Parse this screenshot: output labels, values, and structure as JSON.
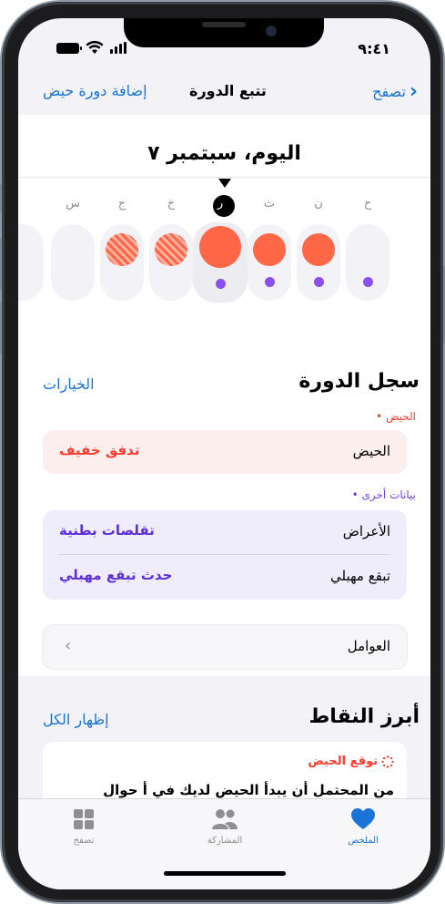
{
  "status": {
    "time": "٩:٤١"
  },
  "nav": {
    "back_label": "تصفح",
    "title": "تتبع الدورة",
    "add_label": "إضافة دورة حيض"
  },
  "calendar": {
    "today_label": "اليوم، سبتمبر ٧",
    "days": [
      {
        "letter": "",
        "flow": "none",
        "spot": false
      },
      {
        "letter": "س",
        "flow": "none",
        "spot": false
      },
      {
        "letter": "ج",
        "flow": "predicted",
        "spot": false
      },
      {
        "letter": "خ",
        "flow": "predicted",
        "spot": false
      },
      {
        "letter": "ر",
        "flow": "heavy",
        "spot": true,
        "today": true
      },
      {
        "letter": "ث",
        "flow": "medium",
        "spot": true
      },
      {
        "letter": "ن",
        "flow": "medium",
        "spot": true
      },
      {
        "letter": "ح",
        "flow": "none",
        "spot": true
      }
    ],
    "colors": {
      "flow": "#ff6747",
      "spotting": "#8b4ff0"
    }
  },
  "cycle_log": {
    "title": "سجل الدورة",
    "options_label": "الخيارات",
    "period_tag": "• الحيض",
    "period_row": {
      "label": "الحيض",
      "value": "تدفق خفيف"
    },
    "other_tag": "• بيانات أخرى",
    "symptoms_row": {
      "label": "الأعراض",
      "value": "تقلصات بطنية"
    },
    "spotting_row": {
      "label": "تبقع مهبلي",
      "value": "حدث تبقع مهبلي"
    },
    "factors_row": {
      "label": "العوامل"
    }
  },
  "highlights": {
    "title": "أبرز النقاط",
    "show_all_label": "إظهار الكل",
    "card_head": "توقع الحيض",
    "card_body": "من المحتمل أن يبدأ الحيض لديك في أ حوال"
  },
  "tabbar": {
    "items": [
      {
        "label": "تصفح",
        "icon": "grid-icon"
      },
      {
        "label": "المشاركة",
        "icon": "people-icon"
      },
      {
        "label": "الملخص",
        "icon": "heart-icon",
        "active": true
      }
    ]
  }
}
